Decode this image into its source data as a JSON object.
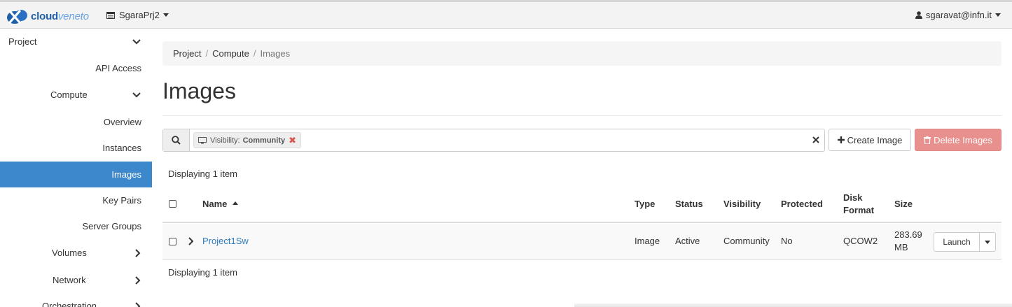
{
  "brand": {
    "name_bold": "cloud",
    "name_light": "veneto"
  },
  "header": {
    "project": "SgaraPrj2",
    "user": "sgaravat@infn.it"
  },
  "sidebar": {
    "items": [
      {
        "label": "Project"
      },
      {
        "label": "API Access"
      },
      {
        "label": "Compute"
      },
      {
        "label": "Overview"
      },
      {
        "label": "Instances"
      },
      {
        "label": "Images"
      },
      {
        "label": "Key Pairs"
      },
      {
        "label": "Server Groups"
      },
      {
        "label": "Volumes"
      },
      {
        "label": "Network"
      },
      {
        "label": "Orchestration"
      }
    ]
  },
  "breadcrumb": {
    "items": [
      "Project",
      "Compute"
    ],
    "current": "Images",
    "sep": "/"
  },
  "page": {
    "title": "Images"
  },
  "filter": {
    "tag_label": "Visibility:",
    "tag_value": "Community",
    "input_value": ""
  },
  "actions": {
    "create": "Create Image",
    "delete": "Delete Images"
  },
  "table": {
    "display_count": "Displaying 1 item",
    "headers": {
      "name": "Name",
      "type": "Type",
      "status": "Status",
      "visibility": "Visibility",
      "protected": "Protected",
      "disk_format_1": "Disk",
      "disk_format_2": "Format",
      "size": "Size"
    },
    "rows": [
      {
        "name": "Project1Sw",
        "type": "Image",
        "status": "Active",
        "visibility": "Community",
        "protected": "No",
        "disk_format": "QCOW2",
        "size_1": "283.69",
        "size_2": "MB",
        "action": "Launch"
      }
    ]
  },
  "colors": {
    "accent": "#3d87cd",
    "link": "#2a7bc1",
    "danger": "#e8908d"
  }
}
